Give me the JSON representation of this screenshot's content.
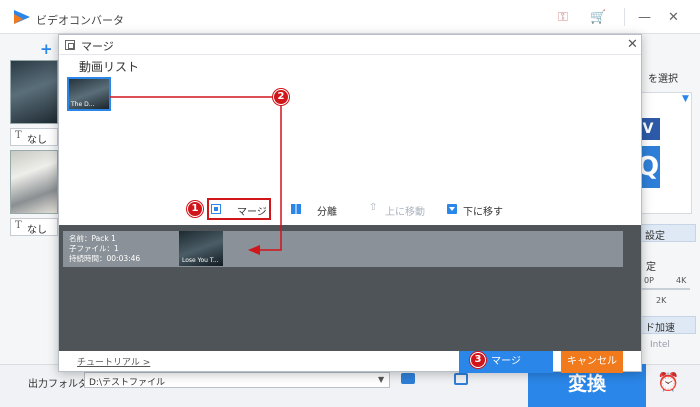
{
  "app": {
    "title": "ビデオコンバータ",
    "add_label": "+",
    "clips": [
      {
        "subtitle": "なし"
      },
      {
        "subtitle": "なし"
      }
    ],
    "right": {
      "select_text": "を選択",
      "format_abbr": "V",
      "setting_label": "設定",
      "quality_label": "定",
      "res_low": "0P",
      "res_high": "4K",
      "res_mid": "2K",
      "hw_label": "ド加速",
      "intel_label": "Intel"
    },
    "bottom": {
      "output_label": "出力フォルダ：",
      "output_path": "D:\\テストファイル",
      "convert_label": "変換"
    }
  },
  "modal": {
    "title": "マージ",
    "list_heading": "動画リスト",
    "video_item_caption": "The D...",
    "toolbar": {
      "merge": "マージ",
      "split": "分離",
      "move_up": "上に移動",
      "move_down": "下に移す"
    },
    "pack": {
      "name": "名前：Pack 1",
      "subfiles": "子ファイル：1",
      "duration": "持続時間：00:03:46",
      "thumb_caption": "Lose You T..."
    },
    "tutorial": "チュートリアル >",
    "merge_button": "マージ",
    "cancel_button": "キャンセル"
  },
  "annotations": {
    "step1": "1",
    "step2": "2",
    "step3": "3",
    "color": "#d0151b"
  }
}
